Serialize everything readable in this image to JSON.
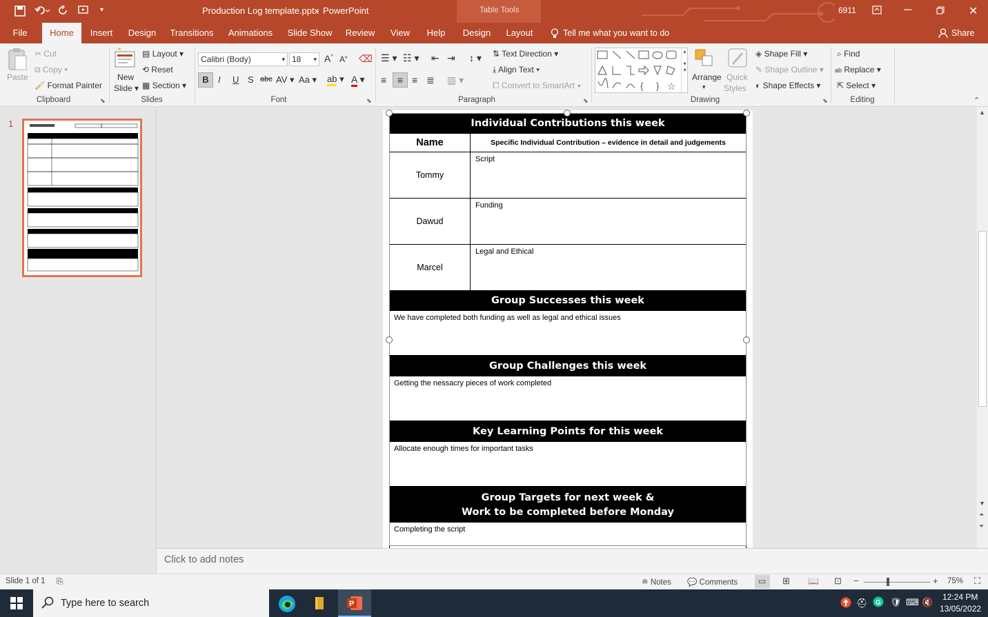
{
  "titlebar": {
    "filename": "Production Log template.pptx",
    "separator": "-",
    "app": "PowerPoint",
    "contextual": "Table Tools",
    "counter": "6911"
  },
  "tabs": [
    "File",
    "Home",
    "Insert",
    "Design",
    "Transitions",
    "Animations",
    "Slide Show",
    "Review",
    "View",
    "Help",
    "Design",
    "Layout"
  ],
  "tellme": "Tell me what you want to do",
  "share": "Share",
  "ribbon": {
    "clipboard": {
      "label": "Clipboard",
      "paste": "Paste",
      "cut": "Cut",
      "copy": "Copy",
      "format_painter": "Format Painter"
    },
    "slides": {
      "label": "Slides",
      "new_slide_1": "New",
      "new_slide_2": "Slide",
      "layout": "Layout",
      "reset": "Reset",
      "section": "Section"
    },
    "font": {
      "label": "Font",
      "name": "Calibri (Body)",
      "size": "18"
    },
    "paragraph": {
      "label": "Paragraph",
      "text_direction": "Text Direction",
      "align_text": "Align Text",
      "smartart": "Convert to SmartArt"
    },
    "drawing": {
      "label": "Drawing",
      "arrange": "Arrange",
      "quick_1": "Quick",
      "quick_2": "Styles",
      "shape_fill": "Shape Fill",
      "shape_outline": "Shape Outline",
      "shape_effects": "Shape Effects"
    },
    "editing": {
      "label": "Editing",
      "find": "Find",
      "replace": "Replace",
      "select": "Select"
    }
  },
  "thumbnail": {
    "number": "1"
  },
  "slide": {
    "contrib_header": "Individual Contributions this week",
    "col_name": "Name",
    "col_detail": "Specific Individual Contribution – evidence in detail and judgements",
    "rows": [
      {
        "name": "Tommy",
        "detail": "Script"
      },
      {
        "name": "Dawud",
        "detail": "Funding"
      },
      {
        "name": "Marcel",
        "detail": "Legal and Ethical"
      }
    ],
    "successes_header": "Group Successes this week",
    "successes_text": "We have completed both funding as well as legal and ethical issues",
    "challenges_header": "Group Challenges this week",
    "challenges_text": "Getting the nessacry pieces of work completed",
    "learning_header": "Key Learning Points for this week",
    "learning_text": "Allocate enough times for important tasks",
    "targets_header_1": "Group Targets for next week &",
    "targets_header_2": "Work to be completed before Monday",
    "targets_text": "Completing the script"
  },
  "notes_placeholder": "Click to add notes",
  "status": {
    "slide": "Slide 1 of 1",
    "notes": "Notes",
    "comments": "Comments",
    "zoom": "75%"
  },
  "taskbar": {
    "search": "Type here to search",
    "time": "12:24 PM",
    "date": "13/05/2022"
  },
  "colors": {
    "accent": "#b7472a",
    "ribbon_bg": "#f3f3f3",
    "canvas_bg": "#e6e6e6",
    "taskbar": "#1f2b38"
  }
}
